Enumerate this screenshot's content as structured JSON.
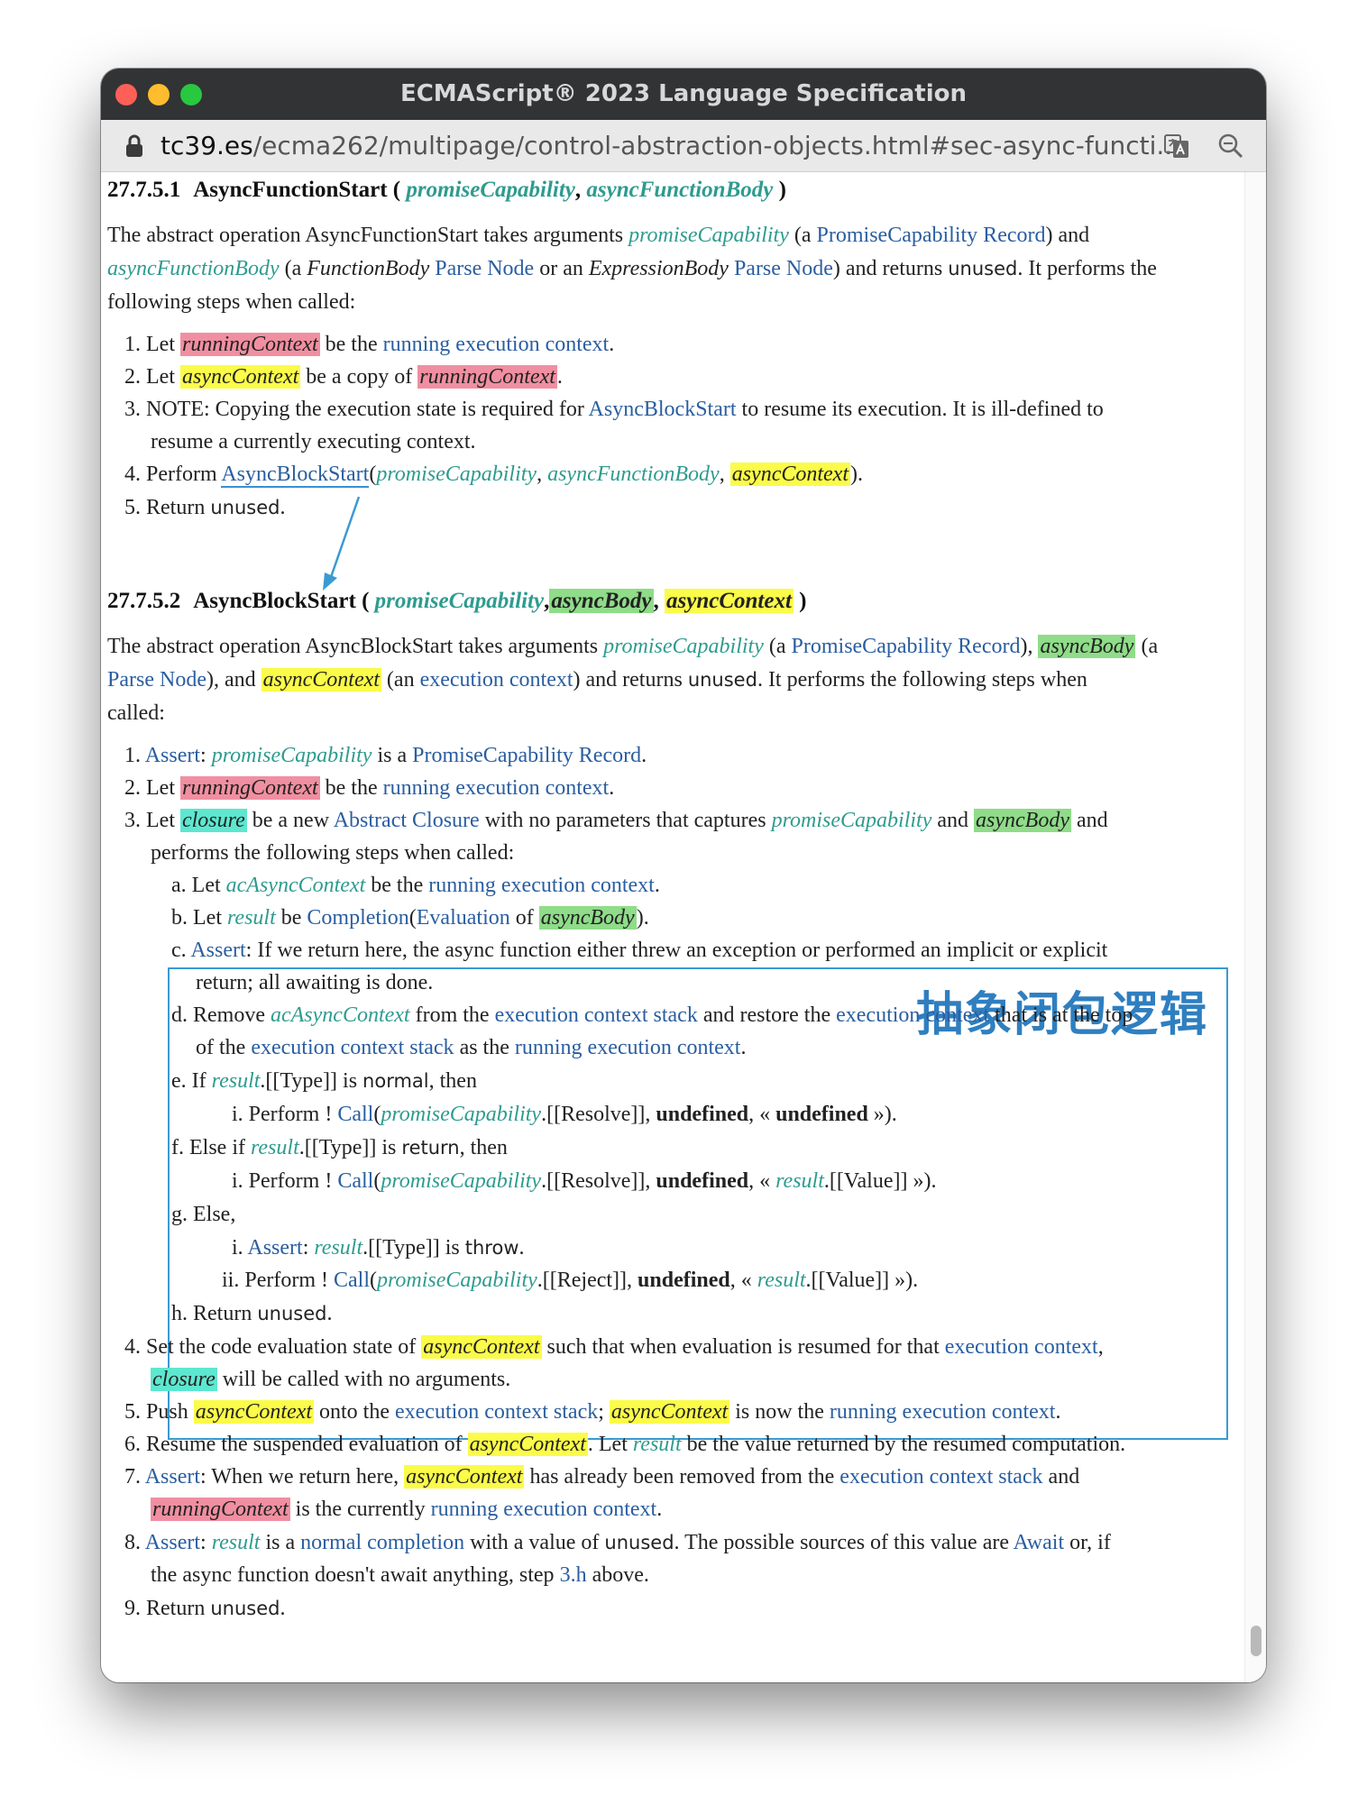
{
  "window": {
    "title": "ECMAScript® 2023 Language Specification"
  },
  "urlbar": {
    "host": "tc39.es",
    "path": "/ecma262/multipage/control-abstraction-objects.html#sec-async-functi..."
  },
  "icons": [
    "lock-icon",
    "translate-icon",
    "zoom-icon"
  ],
  "colors": {
    "highlight_red": "#f08fa1",
    "highlight_yellow": "#fbfb49",
    "highlight_green": "#8fdc89",
    "highlight_teal": "#5de7d0",
    "link": "#2a5ea0",
    "variable": "#2e9b8f",
    "annotation_box": "#3a9ad2"
  },
  "sec1": {
    "number": "27.7.5.1",
    "name": "AsyncFunctionStart",
    "open": "(",
    "close": ")",
    "comma": ",",
    "params": [
      "promiseCapability",
      "asyncFunctionBody"
    ],
    "intro": {
      "t1": "The abstract operation AsyncFunctionStart takes arguments ",
      "v1": "promiseCapability",
      "t2": " (a ",
      "l1": "PromiseCapability Record",
      "t3": ") and",
      "v2": "asyncFunctionBody",
      "t4": " (a ",
      "i1": "FunctionBody",
      "t5": " ",
      "l2": "Parse Node",
      "t6": " or an ",
      "i2": "ExpressionBody",
      "t7": " ",
      "l3": "Parse Node",
      "t8": ") and returns ",
      "s1": "unused",
      "t9": ". It performs the",
      "t10": "following steps when called:"
    },
    "steps": {
      "s1": {
        "m": "1.",
        "a": " Let ",
        "v": "runningContext",
        "b": " be the ",
        "l": "running execution context",
        "c": "."
      },
      "s2": {
        "m": "2.",
        "a": " Let ",
        "v": "asyncContext",
        "b": " be a copy of ",
        "v2": "runningContext",
        "c": "."
      },
      "s3": {
        "m": "3.",
        "a": " NOTE: Copying the execution state is required for ",
        "l": "AsyncBlockStart",
        "b": " to resume its execution. It is ill-defined to",
        "line2": "resume a currently executing context."
      },
      "s4": {
        "m": "4.",
        "a": " Perform ",
        "l": "AsyncBlockStart",
        "p1": "(",
        "v1": "promiseCapability",
        "cm1": ", ",
        "v2": "asyncFunctionBody",
        "cm2": ", ",
        "v3": "asyncContext",
        "p2": ")."
      },
      "s5": {
        "m": "5.",
        "a": " Return ",
        "s": "unused",
        "c": "."
      }
    }
  },
  "sec2": {
    "number": "27.7.5.2",
    "name": "AsyncBlockStart",
    "open": "(",
    "close": ")",
    "comma": ",",
    "params": [
      "promiseCapability",
      "asyncBody",
      "asyncContext"
    ],
    "intro": {
      "t1": "The abstract operation AsyncBlockStart takes arguments ",
      "v1": "promiseCapability",
      "t2": " (a ",
      "l1": "PromiseCapability Record",
      "t3": "), ",
      "v2": "asyncBody",
      "t4": " (a",
      "l2": "Parse Node",
      "t5": "), and ",
      "v3": "asyncContext",
      "t6": " (an ",
      "l3": "execution context",
      "t7": ") and returns ",
      "s1": "unused",
      "t8": ". It performs the following steps when",
      "t9": "called:"
    },
    "steps": {
      "s1": {
        "m": "1.",
        "l": "Assert",
        "a": ": ",
        "v": "promiseCapability",
        "b": " is a ",
        "l2": "PromiseCapability Record",
        "c": "."
      },
      "s2": {
        "m": "2.",
        "a": " Let ",
        "v": "runningContext",
        "b": " be the ",
        "l": "running execution context",
        "c": "."
      },
      "s3": {
        "m": "3.",
        "a": " Let ",
        "v": "closure",
        "b": " be a new ",
        "l": "Abstract Closure",
        "c": " with no parameters that captures ",
        "v2": "promiseCapability",
        "d": " and ",
        "v3": "asyncBody",
        "e": " and",
        "line2": "performs the following steps when called:"
      },
      "a": {
        "m": "a.",
        "t1": " Let ",
        "v1": "acAsyncContext",
        "t2": " be the ",
        "l1": "running execution context",
        "t3": "."
      },
      "b": {
        "m": "b.",
        "t1": " Let ",
        "v1": "result",
        "t2": " be ",
        "l1": "Completion",
        "t3": "(",
        "l2": "Evaluation",
        "t4": " of ",
        "v2": "asyncBody",
        "t5": ")."
      },
      "c": {
        "m": "c.",
        "l1": "Assert",
        "t1": ": If we return here, the async function either threw an exception or performed an implicit or explicit",
        "line2": "return; all awaiting is done."
      },
      "d": {
        "m": "d.",
        "t1": " Remove ",
        "v1": "acAsyncContext",
        "t2": " from the ",
        "l1": "execution context stack",
        "t3": " and restore the ",
        "l2": "execution context",
        "t4": " that is at the top",
        "t5": "of the ",
        "l3": "execution context stack",
        "t6": " as the ",
        "l4": "running execution context",
        "t7": "."
      },
      "e": {
        "m": "e.",
        "t1": " If ",
        "v1": "result",
        "t2": ".[[Type]] is ",
        "s1": "normal",
        "t3": ", then"
      },
      "ei": {
        "m": "i.",
        "t1": " Perform ! ",
        "l1": "Call",
        "t2": "(",
        "v1": "promiseCapability",
        "t3": ".[[Resolve]], ",
        "b1": "undefined",
        "t4": ", « ",
        "b2": "undefined",
        "t5": " »)."
      },
      "f": {
        "m": "f.",
        "t1": " Else if ",
        "v1": "result",
        "t2": ".[[Type]] is ",
        "s1": "return",
        "t3": ", then"
      },
      "fi": {
        "m": "i.",
        "t1": " Perform ! ",
        "l1": "Call",
        "t2": "(",
        "v1": "promiseCapability",
        "t3": ".[[Resolve]], ",
        "b1": "undefined",
        "t4": ", « ",
        "v2": "result",
        "t5": ".[[Value]] »)."
      },
      "g": {
        "m": "g.",
        "t1": " Else,"
      },
      "gi": {
        "m": "i.",
        "l1": "Assert",
        "t1": ": ",
        "v1": "result",
        "t2": ".[[Type]] is ",
        "s1": "throw",
        "t3": "."
      },
      "gii": {
        "m": "ii.",
        "t1": " Perform ! ",
        "l1": "Call",
        "t2": "(",
        "v1": "promiseCapability",
        "t3": ".[[Reject]], ",
        "b1": "undefined",
        "t4": ", « ",
        "v2": "result",
        "t5": ".[[Value]] »)."
      },
      "h": {
        "m": "h.",
        "t1": " Return ",
        "s1": "unused",
        "t2": "."
      },
      "s4": {
        "m": "4.",
        "t1": " Set the code evaluation state of ",
        "v1": "asyncContext",
        "t2": " such that when evaluation is resumed for that ",
        "l1": "execution context",
        "t3": ",",
        "v2": "closure",
        "t4": " will be called with no arguments."
      },
      "s5": {
        "m": "5.",
        "t1": " Push ",
        "v1": "asyncContext",
        "t2": " onto the ",
        "l1": "execution context stack",
        "t3": "; ",
        "v2": "asyncContext",
        "t4": " is now the ",
        "l2": "running execution context",
        "t5": "."
      },
      "s6": {
        "m": "6.",
        "t1": " Resume the suspended evaluation of ",
        "v1": "asyncContext",
        "t2": ". Let ",
        "v2": "result",
        "t3": " be the value returned by the resumed computation."
      },
      "s7": {
        "m": "7.",
        "l1": "Assert",
        "t1": ": When we return here, ",
        "v1": "asyncContext",
        "t2": " has already been removed from the ",
        "l2": "execution context stack",
        "t3": " and",
        "v2": "runningContext",
        "t4": " is the currently ",
        "l3": "running execution context",
        "t5": "."
      },
      "s8": {
        "m": "8.",
        "l1": "Assert",
        "t1": ": ",
        "v1": "result",
        "t2": " is a ",
        "l2": "normal completion",
        "t3": " with a value of ",
        "s1": "unused",
        "t4": ". The possible sources of this value are ",
        "l3": "Await",
        "t5": " or, if",
        "t6": "the async function doesn't await anything, step ",
        "l4": "3.h",
        "t7": " above."
      },
      "s9": {
        "m": "9.",
        "t1": " Return ",
        "s1": "unused",
        "t2": "."
      }
    }
  },
  "annotation": {
    "label": "抽象闭包逻辑"
  }
}
